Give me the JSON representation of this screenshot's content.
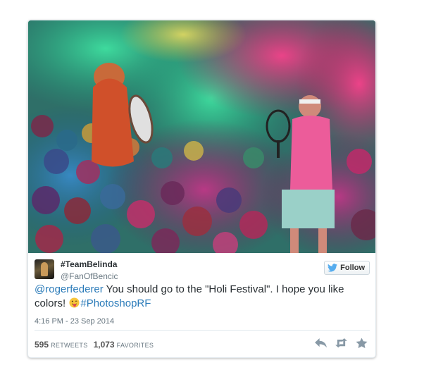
{
  "tweet": {
    "display_name": "#TeamBelinda",
    "screen_name": "@FanOfBencic",
    "follow_label": "Follow",
    "text": {
      "mention": "@rogerfederer",
      "body": " You should go to the \"Holi Festival\". I hope you like colors! ",
      "hashtag": "#PhotoshopRF"
    },
    "timestamp": "4:16 PM - 23 Sep 2014",
    "retweets_count": "595",
    "retweets_label": "RETWEETS",
    "favorites_count": "1,073",
    "favorites_label": "FAVORITES",
    "media_icon": "holi-festival-photo",
    "actions": [
      {
        "icon": "reply-icon"
      },
      {
        "icon": "retweet-icon"
      },
      {
        "icon": "favorite-icon"
      }
    ]
  },
  "colors": {
    "link": "#2b7bb9",
    "text": "#292f33",
    "muted": "#66757f",
    "twitter_blue": "#55acee",
    "action_gray": "#8899a6"
  }
}
